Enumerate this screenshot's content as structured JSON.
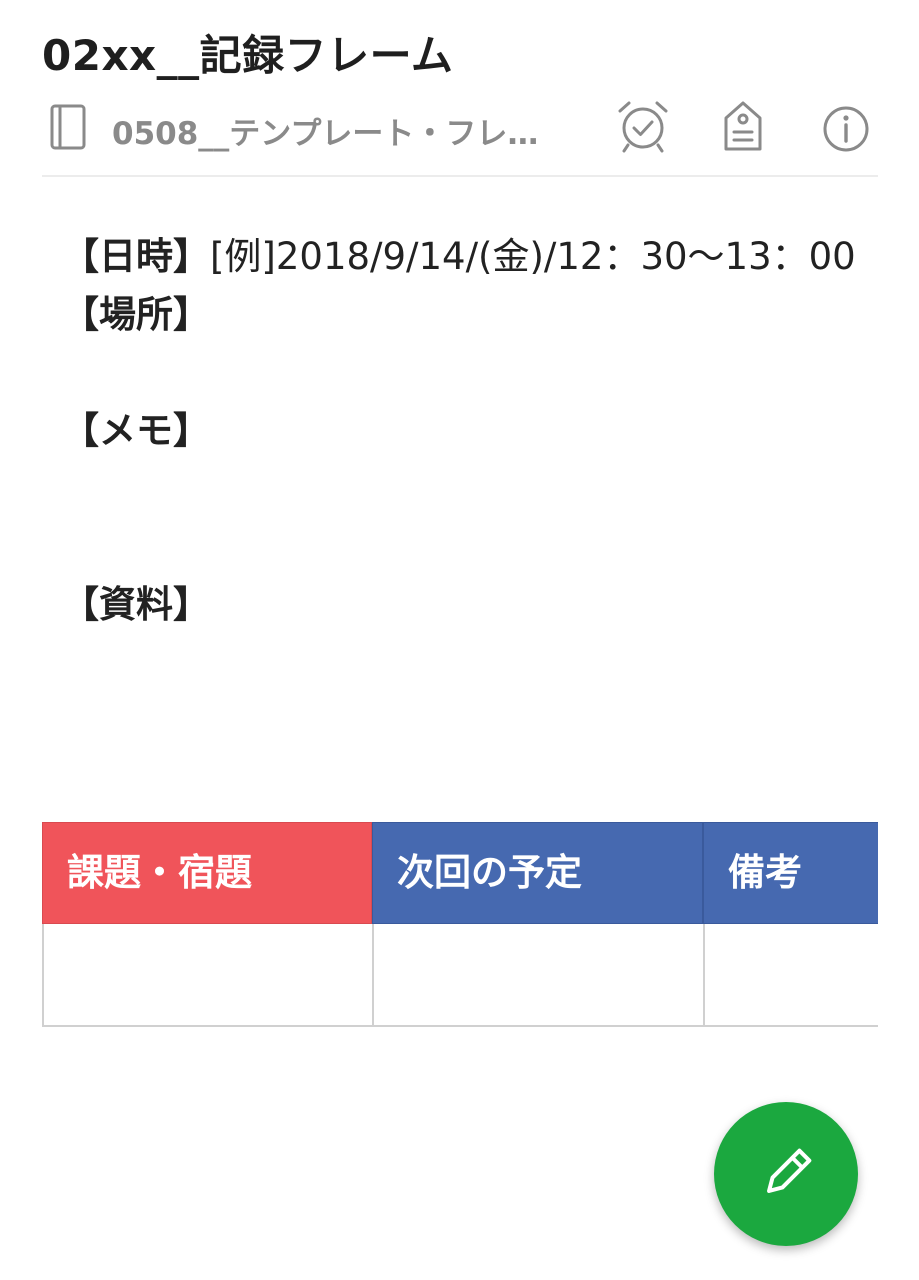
{
  "note": {
    "title": "02xx__記録フレーム",
    "notebook_name": "0508__テンプレート・フレ…"
  },
  "toolbar": {
    "icons": [
      "notebook-icon",
      "alarm-icon",
      "tag-icon",
      "info-icon"
    ]
  },
  "content": {
    "datetime_label": "【日時】",
    "datetime_value": "[例]2018/9/14/(金)/12：30〜13：00",
    "place_label": "【場所】",
    "memo_label": "【メモ】",
    "materials_label": "【資料】"
  },
  "table": {
    "headers": [
      "課題・宿題",
      "次回の予定",
      "備考"
    ],
    "rows": [
      [
        "",
        "",
        ""
      ]
    ]
  },
  "fab": {
    "icon": "pencil-icon"
  },
  "colors": {
    "header_red": "#f0545a",
    "header_blue": "#4669b0",
    "fab_green": "#1ba83f"
  }
}
